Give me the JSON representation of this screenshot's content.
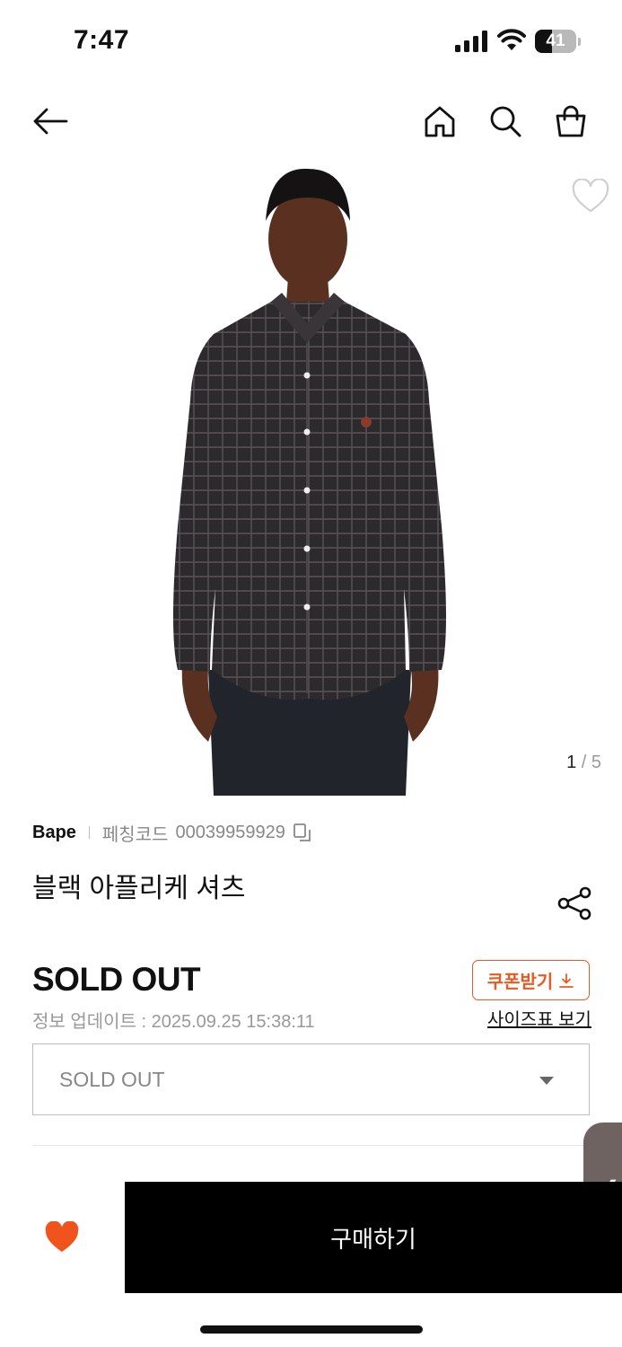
{
  "status_bar": {
    "time": "7:47",
    "battery": "41",
    "battery_level": 0.41
  },
  "nav": {
    "back_icon": "arrow-left-icon",
    "home_icon": "home-icon",
    "search_icon": "search-icon",
    "cart_icon": "shopping-bag-icon"
  },
  "gallery": {
    "current": "1",
    "separator": " / ",
    "total": "5"
  },
  "product": {
    "brand": "Bape",
    "code_label": "페칭코드",
    "code_value": "00039959929",
    "title": "블랙 아플리케 셔츠",
    "price_status": "SOLD OUT",
    "info_update": "정보 업데이트 : 2025.09.25 15:38:11"
  },
  "actions": {
    "coupon_label": "쿠폰받기",
    "size_chart_label": "사이즈표 보기",
    "option_placeholder": "SOLD OUT",
    "buy_label": "구매하기"
  },
  "colors": {
    "accent": "#e85a23",
    "buy_bg": "#000000",
    "heart": "#f0531c"
  }
}
